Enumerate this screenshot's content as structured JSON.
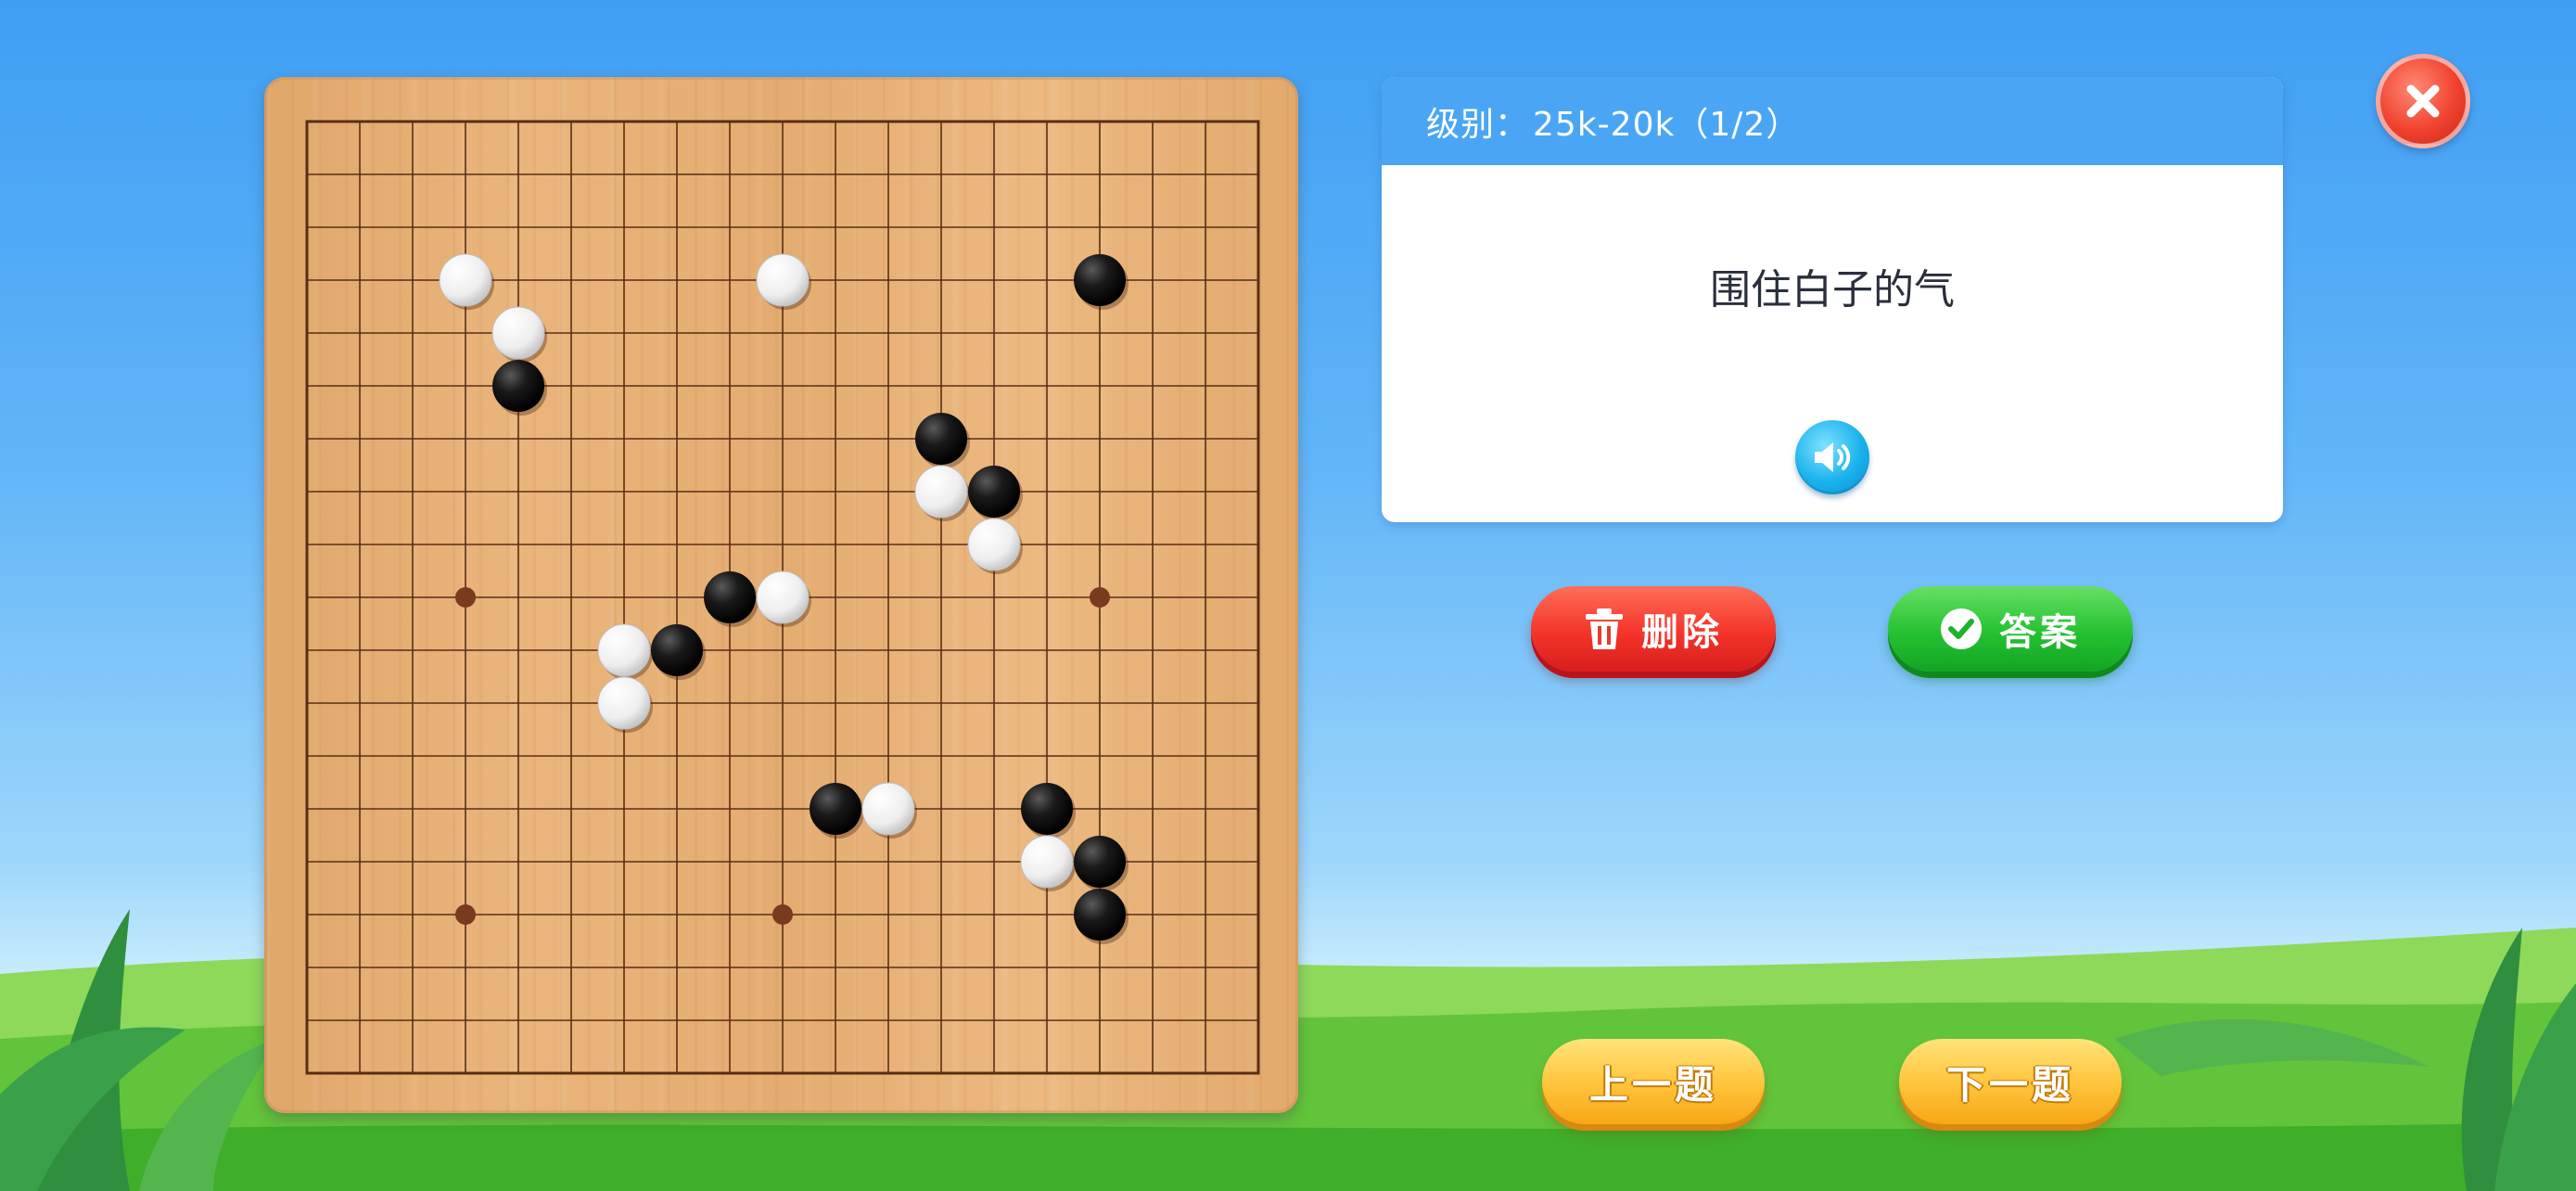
{
  "header": {
    "level_label": "级别：",
    "level_value": "25k-20k（1/2）"
  },
  "prompt": {
    "text": "围住白子的气"
  },
  "icons": {
    "speaker": "speaker-icon",
    "trash": "trash-icon",
    "check": "check-circle-icon",
    "close": "close-icon"
  },
  "buttons": {
    "delete_label": "删除",
    "answer_label": "答案",
    "prev_label": "上一题",
    "next_label": "下一题"
  },
  "colors": {
    "sky": "#3f9ef3",
    "header": "#4aa6f4",
    "delete": "#f4342a",
    "answer": "#25c131",
    "nav": "#ffc33a",
    "close": "#f0432f"
  },
  "board": {
    "size": 19,
    "star_points": [
      [
        3,
        9
      ],
      [
        15,
        9
      ],
      [
        3,
        15
      ],
      [
        9,
        15
      ]
    ],
    "stones": [
      {
        "color": "white",
        "col": 3,
        "row": 3
      },
      {
        "color": "white",
        "col": 4,
        "row": 4
      },
      {
        "color": "black",
        "col": 4,
        "row": 5
      },
      {
        "color": "white",
        "col": 9,
        "row": 3
      },
      {
        "color": "black",
        "col": 15,
        "row": 3
      },
      {
        "color": "black",
        "col": 12,
        "row": 6
      },
      {
        "color": "white",
        "col": 12,
        "row": 7
      },
      {
        "color": "black",
        "col": 13,
        "row": 7
      },
      {
        "color": "white",
        "col": 13,
        "row": 8
      },
      {
        "color": "black",
        "col": 8,
        "row": 9
      },
      {
        "color": "white",
        "col": 9,
        "row": 9
      },
      {
        "color": "white",
        "col": 6,
        "row": 10
      },
      {
        "color": "black",
        "col": 7,
        "row": 10
      },
      {
        "color": "white",
        "col": 6,
        "row": 11
      },
      {
        "color": "black",
        "col": 10,
        "row": 13
      },
      {
        "color": "white",
        "col": 11,
        "row": 13
      },
      {
        "color": "black",
        "col": 14,
        "row": 13
      },
      {
        "color": "white",
        "col": 14,
        "row": 14
      },
      {
        "color": "black",
        "col": 15,
        "row": 14
      },
      {
        "color": "black",
        "col": 15,
        "row": 15
      }
    ]
  }
}
